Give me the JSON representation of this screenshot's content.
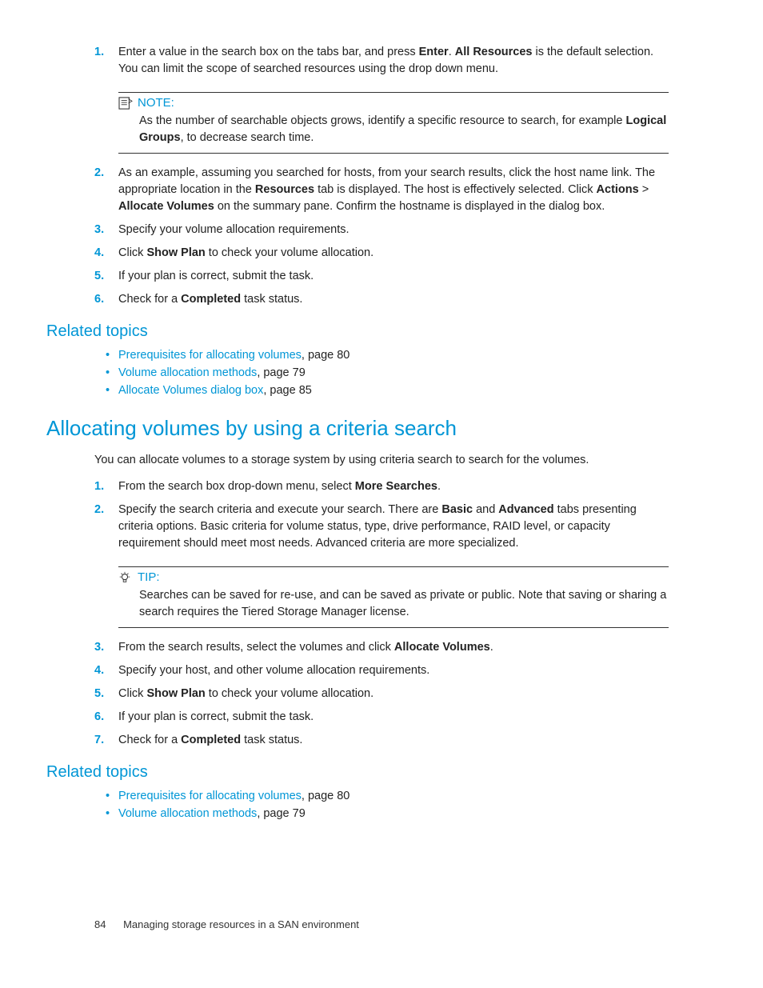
{
  "sec1": {
    "steps": [
      {
        "n": "1.",
        "html": "Enter a value in the search box on the tabs bar, and press <span class='bold'>Enter</span>. <span class='bold'>All Resources</span> is the default selection. You can limit the scope of searched resources using the drop down menu."
      },
      {
        "n": "2.",
        "html": "As an example, assuming you searched for hosts, from your search results, click the host name link. The appropriate location in the <span class='bold'>Resources</span> tab is displayed. The host is effectively selected. Click <span class='bold'>Actions</span> &gt; <span class='bold'>Allocate Volumes</span> on the summary pane. Confirm the hostname is displayed in the dialog box."
      },
      {
        "n": "3.",
        "html": "Specify your volume allocation requirements."
      },
      {
        "n": "4.",
        "html": "Click <span class='bold'>Show Plan</span> to check your volume allocation."
      },
      {
        "n": "5.",
        "html": "If your plan is correct, submit the task."
      },
      {
        "n": "6.",
        "html": "Check for a <span class='bold'>Completed</span> task status."
      }
    ],
    "note_label": "NOTE:",
    "note_body": "As the number of searchable objects grows, identify a specific resource to search, for example <span class='bold'>Logical Groups</span>, to decrease search time."
  },
  "related1": {
    "heading": "Related topics",
    "items": [
      {
        "link": "Prerequisites for allocating volumes",
        "suffix": ", page 80"
      },
      {
        "link": "Volume allocation methods",
        "suffix": ", page 79"
      },
      {
        "link": "Allocate Volumes dialog box",
        "suffix": ", page 85"
      }
    ]
  },
  "sec2": {
    "heading": "Allocating volumes by using a criteria search",
    "intro": "You can allocate volumes to a storage system by using criteria search to search for the volumes.",
    "steps": [
      {
        "n": "1.",
        "html": "From the search box drop-down menu, select <span class='bold'>More Searches</span>."
      },
      {
        "n": "2.",
        "html": "Specify the search criteria and execute your search. There are <span class='bold'>Basic</span> and <span class='bold'>Advanced</span> tabs presenting criteria options. Basic criteria for volume status, type, drive performance, RAID level, or capacity requirement should meet most needs. Advanced criteria are more specialized."
      },
      {
        "n": "3.",
        "html": "From the search results, select the volumes and click <span class='bold'>Allocate Volumes</span>."
      },
      {
        "n": "4.",
        "html": "Specify your host, and other volume allocation requirements."
      },
      {
        "n": "5.",
        "html": "Click <span class='bold'>Show Plan</span> to check your volume allocation."
      },
      {
        "n": "6.",
        "html": "If your plan is correct, submit the task."
      },
      {
        "n": "7.",
        "html": "Check for a <span class='bold'>Completed</span> task status."
      }
    ],
    "tip_label": "TIP:",
    "tip_body": "Searches can be saved for re-use, and can be saved as private or public. Note that saving or sharing a search requires the Tiered Storage Manager license."
  },
  "related2": {
    "heading": "Related topics",
    "items": [
      {
        "link": "Prerequisites for allocating volumes",
        "suffix": ", page 80"
      },
      {
        "link": "Volume allocation methods",
        "suffix": ", page 79"
      }
    ]
  },
  "footer": {
    "page": "84",
    "title": "Managing storage resources in a SAN environment"
  }
}
